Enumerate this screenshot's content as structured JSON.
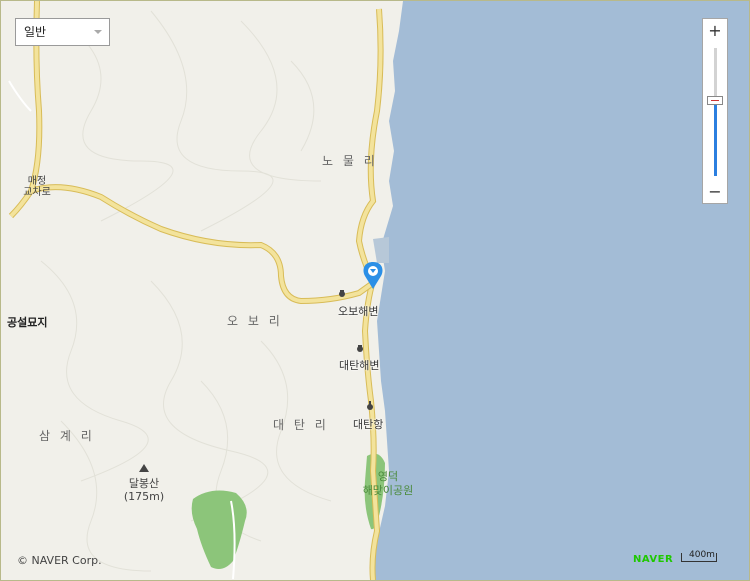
{
  "map_type_selector": {
    "selected": "일반"
  },
  "zoom_control": {
    "zoom_in_label": "+",
    "zoom_out_label": "−",
    "level_fraction": 0.59
  },
  "places": {
    "nomul_ri": "노 물 리",
    "maejeong_line1": "매정",
    "maejeong_line2": "교차로",
    "obo_ri": "오 보 리",
    "gongseol": "공설묘지",
    "obo_beach": "오보해변",
    "daetan_beach": "대탄해변",
    "daetan_port": "대탄항",
    "samgye_ri": "삼 계 리",
    "daetan_ri": "대 탄 리",
    "dalbongsan": "달봉산",
    "dalbongsan_elev": "(175m)",
    "yeongdeok_line1": "영덕",
    "yeongdeok_line2": "해맞이공원"
  },
  "footer": {
    "copyright": "© NAVER Corp.",
    "brand": "NAVER",
    "scale": "400m"
  },
  "colors": {
    "sea": "#a3bcd6",
    "land": "#f1f0ea",
    "road": "#f3e39c",
    "road_edge": "#d8bc58",
    "park": "#8cc57a",
    "marker": "#2b8fe6"
  }
}
